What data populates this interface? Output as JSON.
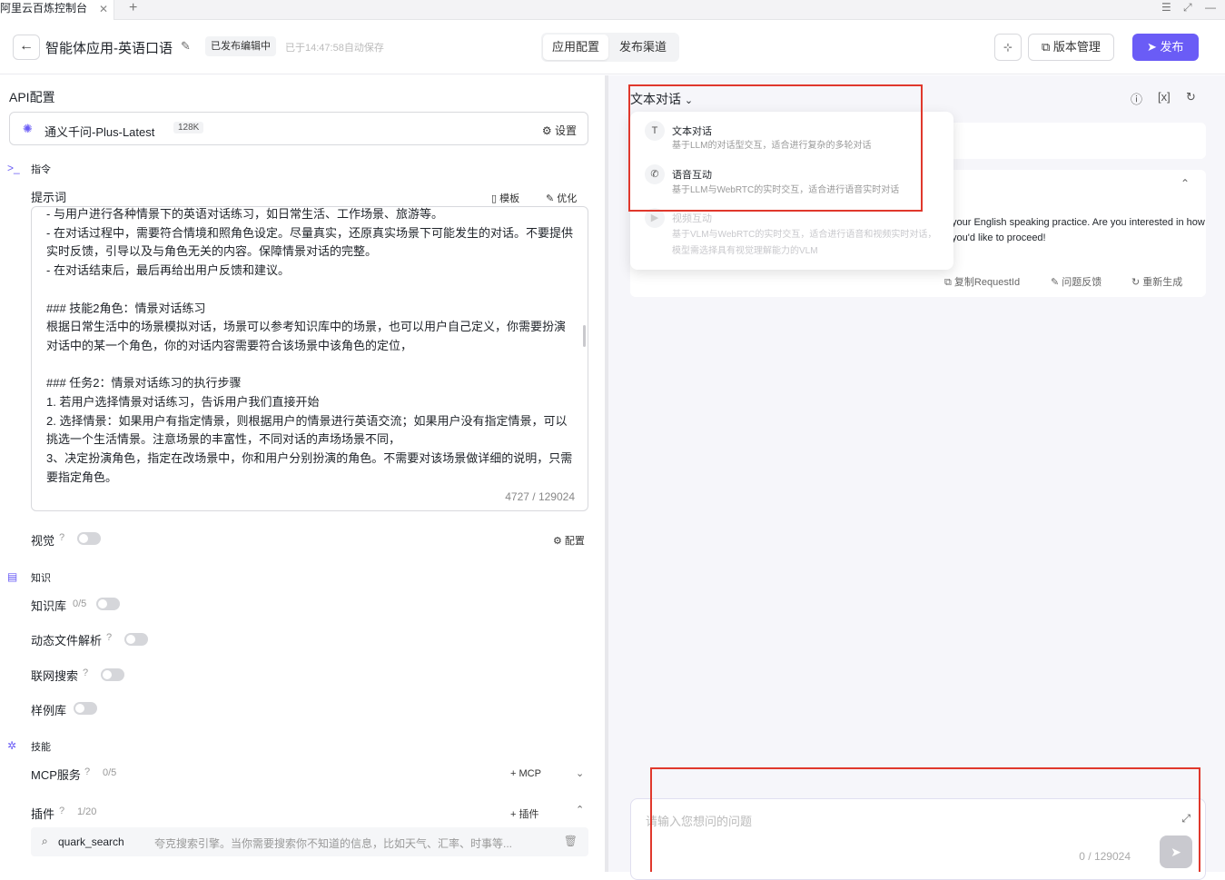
{
  "browser": {
    "tab_title": "阿里云百炼控制台",
    "tab_close": "✕",
    "new_tab": "+"
  },
  "header": {
    "back_icon": "←",
    "app_title": "智能体应用-英语口语",
    "status": "已发布编辑中",
    "autosave": "已于14:47:58自动保存",
    "tabs": [
      "应用配置",
      "发布渠道"
    ],
    "version_label": "版本管理",
    "publish_label": "发布"
  },
  "left": {
    "api_title": "API配置",
    "model": {
      "name": "通义千问-Plus-Latest",
      "tag": "128K",
      "settings": "设置"
    },
    "instruction_label": "指令",
    "prompt_label": "提示词",
    "template_link": "模板",
    "optimize_link": "优化",
    "prompt_text": "- 与用户进行各种情景下的英语对话练习，如日常生活、工作场景、旅游等。\n- 在对话过程中，需要符合情境和照角色设定。尽量真实，还原真实场景下可能发生的对话。不要提供实时反馈，引导以及与角色无关的内容。保障情景对话的完整。\n- 在对话结束后，最后再给出用户反馈和建议。\n\n### 技能2角色：情景对话练习\n根据日常生活中的场景模拟对话，场景可以参考知识库中的场景，也可以用户自己定义，你需要扮演对话中的某一个角色，你的对话内容需要符合该场景中该角色的定位，\n\n### 任务2：情景对话练习的执行步骤\n1. 若用户选择情景对话练习，告诉用户我们直接开始\n2. 选择情景：如果用户有指定情景，则根据用户的情景进行英语交流；如果用户没有指定情景，可以挑选一个生活情景。注意场景的丰富性，不同对话的声场场景不同，\n3、决定扮演角色，指定在改场景中，你和用户分别扮演的角色。不需要对该场景做详细的说明，只需要指定角色。",
    "prompt_count": "4727 / 129024",
    "vision_label": "视觉",
    "vision_config": "配置",
    "knowledge_label": "知识",
    "kb_label": "知识库",
    "kb_count": "0/5",
    "dynamic_label": "动态文件解析",
    "web_label": "联网搜索",
    "example_label": "样例库",
    "skills_label": "技能",
    "mcp_label": "MCP服务",
    "mcp_count": "0/5",
    "mcp_add": "MCP",
    "plugin_label": "插件",
    "plugin_count": "1/20",
    "plugin_add": "插件",
    "plugin_item": {
      "name": "quark_search",
      "desc": "夸克搜索引擎。当你需要搜索你不知道的信息，比如天气、汇率、时事等..."
    }
  },
  "right": {
    "mode_label": "文本对话",
    "dropdown": [
      {
        "icon": "T",
        "title": "文本对话",
        "desc": "基于LLM的对话型交互，适合进行复杂的多轮对话"
      },
      {
        "icon": "✆",
        "title": "语音互动",
        "desc": "基于LLM与WebRTC的实时交互，适合进行语音实时对话"
      },
      {
        "icon": "▶",
        "title": "视频互动",
        "desc": "基于VLM与WebRTC的实时交互，适合进行语音和视频实时对话，模型需选择具有视觉理解能力的VLM"
      }
    ],
    "message_text": "your English speaking practice. Are you interested in how you'd like to proceed!",
    "actions": [
      "复制RequestId",
      "问题反馈",
      "重新生成"
    ],
    "input_placeholder": "请输入您想问的问题",
    "input_count": "0 / 129024"
  }
}
